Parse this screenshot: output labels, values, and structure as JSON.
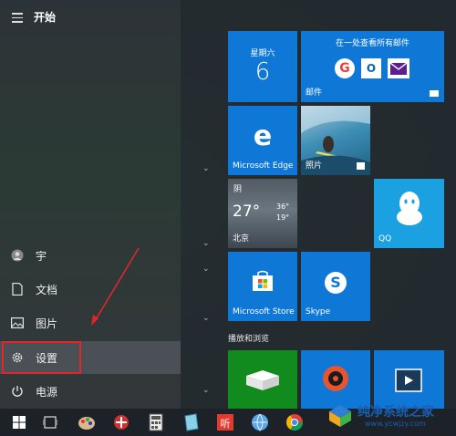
{
  "menu": {
    "title": "开始"
  },
  "user": {
    "name": "宇"
  },
  "rail": {
    "documents": "文档",
    "pictures": "图片",
    "settings": "设置",
    "power": "电源"
  },
  "tiles": {
    "calendar": {
      "weekday": "星期六",
      "day": "6"
    },
    "mail": {
      "header": "在一处查看所有邮件",
      "label": "邮件"
    },
    "edge": {
      "label": "Microsoft Edge"
    },
    "photos": {
      "label": "照片"
    },
    "weather": {
      "condition": "阴",
      "temp": "27°",
      "high": "36°",
      "low": "19°",
      "city": "北京"
    },
    "qq": {
      "label": "QQ"
    },
    "store": {
      "label": "Microsoft Store"
    },
    "skype": {
      "label": "Skype"
    }
  },
  "section": {
    "label": "播放和浏览"
  },
  "taskbar": {
    "icons": [
      "windows-start",
      "task-view",
      "paint",
      "network",
      "calculator",
      "notepad",
      "media",
      "browser-globe",
      "chrome"
    ]
  },
  "watermark": {
    "line1": "纯净系统之家",
    "line2": "www.ycwjzy.com"
  },
  "colors": {
    "tile_blue": "#0f78d7",
    "highlight_red": "#e02626",
    "qq_teal": "#1ba1e2"
  }
}
